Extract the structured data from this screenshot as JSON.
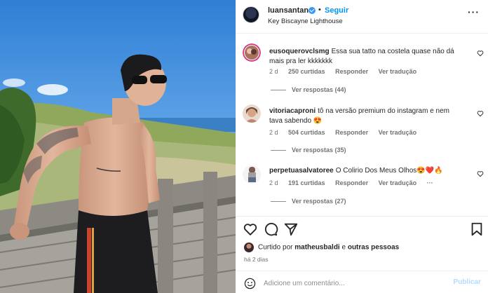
{
  "post": {
    "username": "luansantana",
    "separator": "•",
    "follow_label": "Seguir",
    "location": "Key Biscayne Lighthouse",
    "more_label": "···"
  },
  "comments": [
    {
      "username": "eusoquerovclsmg",
      "text": "Essa sua tatto na costela quase não dá mais pra ler kkkkkkk",
      "time": "2 d",
      "likes": "250 curtidas",
      "reply_label": "Responder",
      "translate_label": "Ver tradução",
      "replies_label": "Ver respostas (44)"
    },
    {
      "username": "vitoriacaproni",
      "text": "tô na versão premium do instagram e nem tava sabendo 😍",
      "time": "2 d",
      "likes": "504 curtidas",
      "reply_label": "Responder",
      "translate_label": "Ver tradução",
      "replies_label": "Ver respostas (35)"
    },
    {
      "username": "perpetuasalvatoree",
      "text": "O Colirio Dos Meus Olhos😍❤️🔥",
      "time": "2 d",
      "likes": "191 curtidas",
      "reply_label": "Responder",
      "translate_label": "Ver tradução",
      "more_label": "···",
      "replies_label": "Ver respostas (27)"
    }
  ],
  "likes": {
    "prefix": "Curtido por",
    "user": "matheusbaldi",
    "middle": "e",
    "others": "outras pessoas"
  },
  "post_time": "há 2 dias",
  "add_comment": {
    "placeholder": "Adicione um comentário...",
    "publish_label": "Publicar"
  },
  "icons": {
    "like": "heart-icon",
    "comment": "comment-icon",
    "share": "share-icon",
    "save": "bookmark-icon",
    "emoji": "emoji-icon",
    "verified": "verified-badge-icon"
  },
  "colors": {
    "accent": "#0095f6",
    "verified": "#3897f0",
    "muted": "#737373",
    "publish_disabled": "#b3dbff"
  }
}
